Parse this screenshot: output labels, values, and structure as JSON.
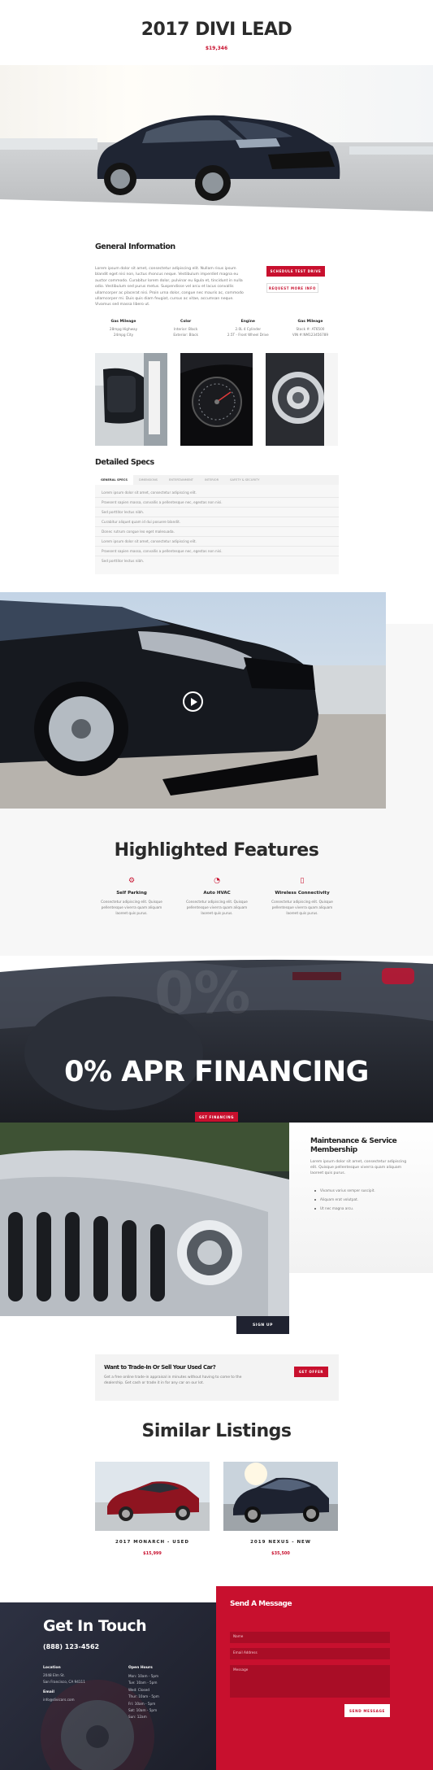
{
  "hero": {
    "title": "2017 DIVI LEAD",
    "price": "$19,346"
  },
  "general": {
    "heading": "General Information",
    "paragraph": "Lorem ipsum dolor sit amet, consectetur adipiscing elit. Nullam risus ipsum blandit eget nisi non, luctus rhoncus neque. Vestibulum imperdiet magna eu auctor commodo. Curabitur lorem dolor, pulvinar eu ligula et, tincidunt in nulla odio. Vestibulum sed purus metus. Suspendisse vel arcu et lacus convallis ullamcorper ac placerat nisi. Proin urna dolor, congue nec mauris ac, commodo ullamcorper mi. Duis quis diam feugiat, cursus ac vitae, accumsan neque. Vivamus sed massa libero ut.",
    "btn_test_drive": "SCHEDULE TEST DRIVE",
    "btn_request": "REQUEST MORE INFO",
    "stats": [
      {
        "label": "Gas Mileage",
        "l1": "28mpg Highway",
        "l2": "24mpg City"
      },
      {
        "label": "Color",
        "l1": "Interior: Black",
        "l2": "Exterior: Black"
      },
      {
        "label": "Engine",
        "l1": "2.0L 4 Cylinder",
        "l2": "2.5T - Front Wheel Drive"
      },
      {
        "label": "Gas Mileage",
        "l1": "Stock #: AT6500",
        "l2": "VIN #:NM123456789"
      }
    ]
  },
  "specs": {
    "heading": "Detailed Specs",
    "tabs": [
      "GENERAL SPECS",
      "DIMENSIONS",
      "ENTERTAINMENT",
      "INTERIOR",
      "SAFETY & SECURITY"
    ],
    "rows": [
      "Lorem ipsum dolor sit amet, consectetur adipiscing elit.",
      "Praesent sapien massa, convallis a pellentesque nec, egestas non nisi.",
      "Sed porttitor lectus nibh.",
      "Curabitur aliquet quam id dui posuere blandit.",
      "Donec rutrum congue leo eget malesuada.",
      "Lorem ipsum dolor sit amet, consectetur adipiscing elit.",
      "Praesent sapien massa, convallis a pellentesque nec, egestas non nisi.",
      "Sed porttitor lectus nibh."
    ]
  },
  "features": {
    "heading": "Highlighted Features",
    "items": [
      {
        "icon": "gear-icon",
        "title": "Self Parking",
        "text": "Consectetur adipiscing elit. Quisque pellentesque viverra quam aliquam laoreet quis purus."
      },
      {
        "icon": "fan-icon",
        "title": "Auto HVAC",
        "text": "Consectetur adipiscing elit. Quisque pellentesque viverra quam aliquam laoreet quis purus."
      },
      {
        "icon": "phone-icon",
        "title": "Wireless Connectivity",
        "text": "Consectetur adipiscing elit. Quisque pellentesque viverra quam aliquam laoreet quis purus."
      }
    ]
  },
  "apr": {
    "bg_text": "0%",
    "heading": "0% APR FINANCING",
    "button": "GET FINANCING"
  },
  "maintenance": {
    "heading": "Maintenance & Service Membership",
    "text": "Lorem ipsum dolor sit amet, consectetur adipiscing elit. Quisque pellentesque viverra quam aliquam laoreet quis purus.",
    "bullets": [
      "Vivamus varius semper suscipit.",
      "Aliquam erat volutpat.",
      "Ut nec magna arcu."
    ],
    "button": "SIGN UP"
  },
  "trade": {
    "heading": "Want to Trade-In Or Sell Your Used Car?",
    "text": "Get a free online trade-in appraisal in minutes without having to come to the dealership. Get cash or trade it in for any car on our lot.",
    "button": "GET OFFER"
  },
  "listings": {
    "heading": "Similar Listings",
    "items": [
      {
        "name": "2017 MONARCH - USED",
        "price": "$15,999"
      },
      {
        "name": "2019 NEXUS - NEW",
        "price": "$35,500"
      }
    ]
  },
  "contact": {
    "heading": "Get In Touch",
    "phone": "(888) 123-4562",
    "location_label": "Location",
    "location": [
      "2048 Elm St.",
      "San Francisco, CA 94111"
    ],
    "email_label": "Email",
    "email": "info@divicars.com",
    "hours_label": "Open Hours",
    "hours": [
      "Mon: 10am - 5pm",
      "Tue: 10am - 5pm",
      "Wed: Closed",
      "Thur: 10am - 5pm",
      "Fri: 10am - 5pm",
      "Sat: 10am - 5pm",
      "Sun: 12am"
    ],
    "form_heading": "Send A Message",
    "name_ph": "Name",
    "email_ph": "Email Address",
    "message_ph": "Message",
    "send": "SEND MESSAGE"
  },
  "colors": {
    "accent": "#c8102e",
    "dark": "#1f2230"
  }
}
